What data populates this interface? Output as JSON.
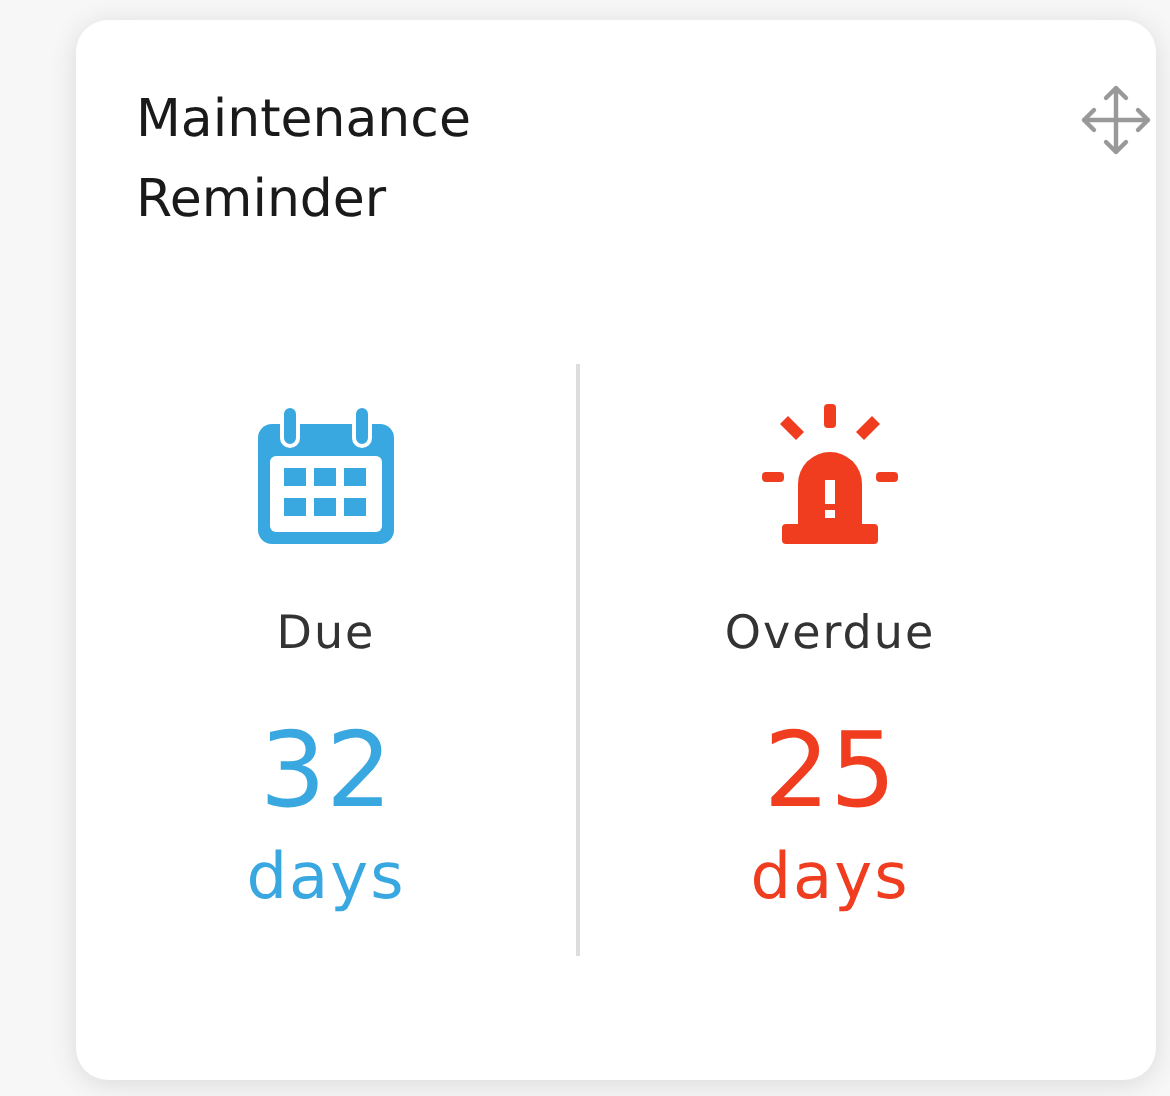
{
  "card": {
    "title": "Maintenance Reminder",
    "stats": [
      {
        "kind": "due",
        "label": "Due",
        "value": "32",
        "unit": "days"
      },
      {
        "kind": "overdue",
        "label": "Overdue",
        "value": "25",
        "unit": "days"
      }
    ]
  }
}
